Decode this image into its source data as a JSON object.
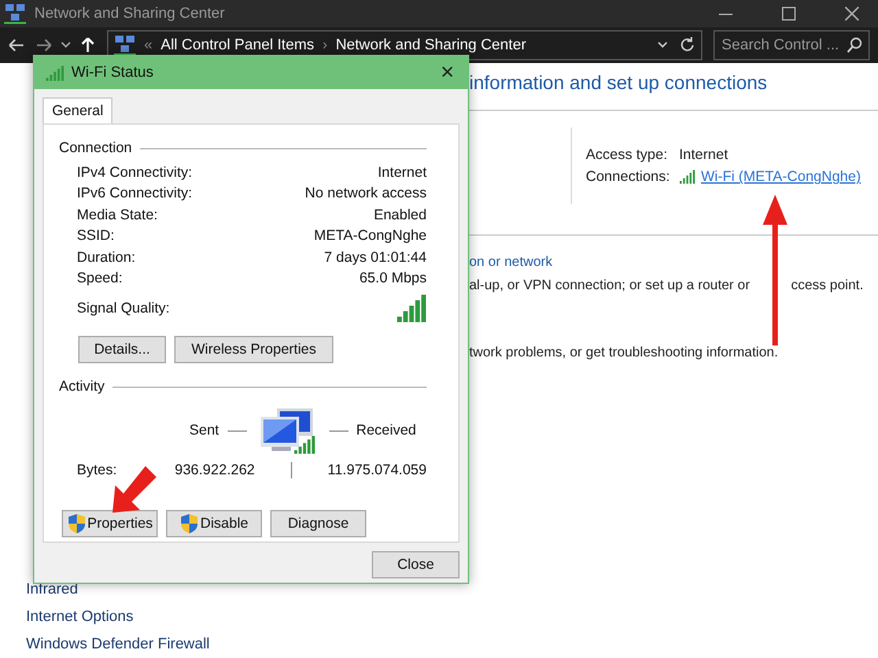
{
  "window": {
    "title": "Network and Sharing Center"
  },
  "address_bar": {
    "crumbs": [
      "All Control Panel Items",
      "Network and Sharing Center"
    ],
    "separator_before": "«",
    "separator": "›"
  },
  "search": {
    "placeholder": "Search Control ..."
  },
  "content": {
    "heading": "information and set up connections",
    "access_type_label": "Access type:",
    "access_type_value": "Internet",
    "connections_label": "Connections:",
    "connection_link": "Wi-Fi (META-CongNghe)",
    "tasks": [
      {
        "kind": "link",
        "text": "on or network"
      },
      {
        "kind": "split",
        "parts": [
          "al-up, or VPN connection; or set up a router or",
          "ccess point."
        ]
      },
      {
        "kind": "text",
        "text": "twork problems, or get troubleshooting information."
      }
    ]
  },
  "sidebar": {
    "items": [
      "Infrared",
      "Internet Options",
      "Windows Defender Firewall"
    ]
  },
  "dialog": {
    "title": "Wi-Fi Status",
    "close": "×",
    "tabs": [
      {
        "label": "General",
        "selected": true
      }
    ],
    "connection": {
      "label": "Connection",
      "rows": [
        {
          "label": "IPv4 Connectivity:",
          "value": "Internet"
        },
        {
          "label": "IPv6 Connectivity:",
          "value": "No network access"
        },
        {
          "label": "Media State:",
          "value": "Enabled"
        },
        {
          "label": "SSID:",
          "value": "META-CongNghe"
        },
        {
          "label": "Duration:",
          "value": "7 days 01:01:44"
        },
        {
          "label": "Speed:",
          "value": "65.0 Mbps"
        }
      ],
      "signal_label": "Signal Quality:",
      "buttons": [
        {
          "label": "Details...",
          "shield": false
        },
        {
          "label": "Wireless Properties",
          "shield": false
        }
      ]
    },
    "activity": {
      "label": "Activity",
      "sent": "Sent",
      "received": "Received",
      "bytes_label": "Bytes:",
      "bytes_sent": "936.922.262",
      "bytes_received": "11.975.074.059"
    },
    "buttons": [
      {
        "label": "Properties",
        "shield": true
      },
      {
        "label": "Disable",
        "shield": true
      },
      {
        "label": "Diagnose",
        "shield": false
      }
    ],
    "close_button": "Close"
  }
}
